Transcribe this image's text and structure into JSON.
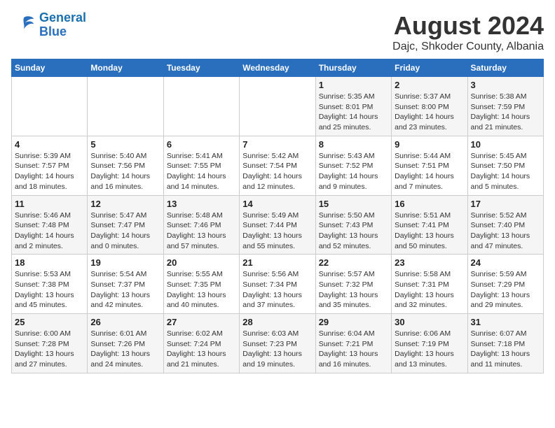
{
  "logo": {
    "line1": "General",
    "line2": "Blue"
  },
  "title": "August 2024",
  "subtitle": "Dajc, Shkoder County, Albania",
  "weekdays": [
    "Sunday",
    "Monday",
    "Tuesday",
    "Wednesday",
    "Thursday",
    "Friday",
    "Saturday"
  ],
  "weeks": [
    [
      {
        "day": "",
        "sunrise": "",
        "sunset": "",
        "daylight": ""
      },
      {
        "day": "",
        "sunrise": "",
        "sunset": "",
        "daylight": ""
      },
      {
        "day": "",
        "sunrise": "",
        "sunset": "",
        "daylight": ""
      },
      {
        "day": "",
        "sunrise": "",
        "sunset": "",
        "daylight": ""
      },
      {
        "day": "1",
        "sunrise": "Sunrise: 5:35 AM",
        "sunset": "Sunset: 8:01 PM",
        "daylight": "Daylight: 14 hours and 25 minutes."
      },
      {
        "day": "2",
        "sunrise": "Sunrise: 5:37 AM",
        "sunset": "Sunset: 8:00 PM",
        "daylight": "Daylight: 14 hours and 23 minutes."
      },
      {
        "day": "3",
        "sunrise": "Sunrise: 5:38 AM",
        "sunset": "Sunset: 7:59 PM",
        "daylight": "Daylight: 14 hours and 21 minutes."
      }
    ],
    [
      {
        "day": "4",
        "sunrise": "Sunrise: 5:39 AM",
        "sunset": "Sunset: 7:57 PM",
        "daylight": "Daylight: 14 hours and 18 minutes."
      },
      {
        "day": "5",
        "sunrise": "Sunrise: 5:40 AM",
        "sunset": "Sunset: 7:56 PM",
        "daylight": "Daylight: 14 hours and 16 minutes."
      },
      {
        "day": "6",
        "sunrise": "Sunrise: 5:41 AM",
        "sunset": "Sunset: 7:55 PM",
        "daylight": "Daylight: 14 hours and 14 minutes."
      },
      {
        "day": "7",
        "sunrise": "Sunrise: 5:42 AM",
        "sunset": "Sunset: 7:54 PM",
        "daylight": "Daylight: 14 hours and 12 minutes."
      },
      {
        "day": "8",
        "sunrise": "Sunrise: 5:43 AM",
        "sunset": "Sunset: 7:52 PM",
        "daylight": "Daylight: 14 hours and 9 minutes."
      },
      {
        "day": "9",
        "sunrise": "Sunrise: 5:44 AM",
        "sunset": "Sunset: 7:51 PM",
        "daylight": "Daylight: 14 hours and 7 minutes."
      },
      {
        "day": "10",
        "sunrise": "Sunrise: 5:45 AM",
        "sunset": "Sunset: 7:50 PM",
        "daylight": "Daylight: 14 hours and 5 minutes."
      }
    ],
    [
      {
        "day": "11",
        "sunrise": "Sunrise: 5:46 AM",
        "sunset": "Sunset: 7:48 PM",
        "daylight": "Daylight: 14 hours and 2 minutes."
      },
      {
        "day": "12",
        "sunrise": "Sunrise: 5:47 AM",
        "sunset": "Sunset: 7:47 PM",
        "daylight": "Daylight: 14 hours and 0 minutes."
      },
      {
        "day": "13",
        "sunrise": "Sunrise: 5:48 AM",
        "sunset": "Sunset: 7:46 PM",
        "daylight": "Daylight: 13 hours and 57 minutes."
      },
      {
        "day": "14",
        "sunrise": "Sunrise: 5:49 AM",
        "sunset": "Sunset: 7:44 PM",
        "daylight": "Daylight: 13 hours and 55 minutes."
      },
      {
        "day": "15",
        "sunrise": "Sunrise: 5:50 AM",
        "sunset": "Sunset: 7:43 PM",
        "daylight": "Daylight: 13 hours and 52 minutes."
      },
      {
        "day": "16",
        "sunrise": "Sunrise: 5:51 AM",
        "sunset": "Sunset: 7:41 PM",
        "daylight": "Daylight: 13 hours and 50 minutes."
      },
      {
        "day": "17",
        "sunrise": "Sunrise: 5:52 AM",
        "sunset": "Sunset: 7:40 PM",
        "daylight": "Daylight: 13 hours and 47 minutes."
      }
    ],
    [
      {
        "day": "18",
        "sunrise": "Sunrise: 5:53 AM",
        "sunset": "Sunset: 7:38 PM",
        "daylight": "Daylight: 13 hours and 45 minutes."
      },
      {
        "day": "19",
        "sunrise": "Sunrise: 5:54 AM",
        "sunset": "Sunset: 7:37 PM",
        "daylight": "Daylight: 13 hours and 42 minutes."
      },
      {
        "day": "20",
        "sunrise": "Sunrise: 5:55 AM",
        "sunset": "Sunset: 7:35 PM",
        "daylight": "Daylight: 13 hours and 40 minutes."
      },
      {
        "day": "21",
        "sunrise": "Sunrise: 5:56 AM",
        "sunset": "Sunset: 7:34 PM",
        "daylight": "Daylight: 13 hours and 37 minutes."
      },
      {
        "day": "22",
        "sunrise": "Sunrise: 5:57 AM",
        "sunset": "Sunset: 7:32 PM",
        "daylight": "Daylight: 13 hours and 35 minutes."
      },
      {
        "day": "23",
        "sunrise": "Sunrise: 5:58 AM",
        "sunset": "Sunset: 7:31 PM",
        "daylight": "Daylight: 13 hours and 32 minutes."
      },
      {
        "day": "24",
        "sunrise": "Sunrise: 5:59 AM",
        "sunset": "Sunset: 7:29 PM",
        "daylight": "Daylight: 13 hours and 29 minutes."
      }
    ],
    [
      {
        "day": "25",
        "sunrise": "Sunrise: 6:00 AM",
        "sunset": "Sunset: 7:28 PM",
        "daylight": "Daylight: 13 hours and 27 minutes."
      },
      {
        "day": "26",
        "sunrise": "Sunrise: 6:01 AM",
        "sunset": "Sunset: 7:26 PM",
        "daylight": "Daylight: 13 hours and 24 minutes."
      },
      {
        "day": "27",
        "sunrise": "Sunrise: 6:02 AM",
        "sunset": "Sunset: 7:24 PM",
        "daylight": "Daylight: 13 hours and 21 minutes."
      },
      {
        "day": "28",
        "sunrise": "Sunrise: 6:03 AM",
        "sunset": "Sunset: 7:23 PM",
        "daylight": "Daylight: 13 hours and 19 minutes."
      },
      {
        "day": "29",
        "sunrise": "Sunrise: 6:04 AM",
        "sunset": "Sunset: 7:21 PM",
        "daylight": "Daylight: 13 hours and 16 minutes."
      },
      {
        "day": "30",
        "sunrise": "Sunrise: 6:06 AM",
        "sunset": "Sunset: 7:19 PM",
        "daylight": "Daylight: 13 hours and 13 minutes."
      },
      {
        "day": "31",
        "sunrise": "Sunrise: 6:07 AM",
        "sunset": "Sunset: 7:18 PM",
        "daylight": "Daylight: 13 hours and 11 minutes."
      }
    ]
  ]
}
